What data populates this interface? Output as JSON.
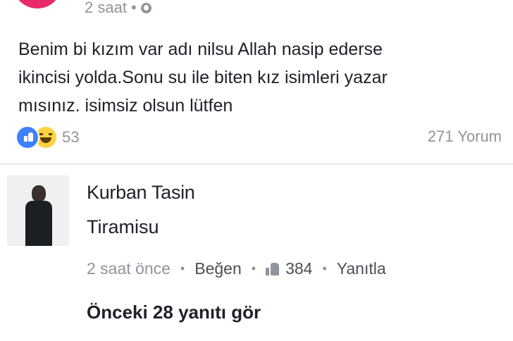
{
  "post": {
    "time": "2 saat",
    "meta_separator": "•",
    "privacy_icon": "globe-icon",
    "text": "Benim bi kızım var adı nilsu Allah nasip ederse\nikincisi yolda.Sonu su ile biten kız isimleri yazar\nmısınız. isimsiz olsun lütfen",
    "reaction_icons": [
      "like-icon",
      "haha-icon"
    ],
    "reaction_count": "53",
    "comment_count": "271 Yorum"
  },
  "comment": {
    "author": "Kurban Tasin",
    "text": "Tiramisu",
    "time": "2 saat önce",
    "separator": "•",
    "like_label": "Beğen",
    "like_icon": "thumbs-up-icon",
    "like_count": "384",
    "reply_label": "Yanıtla"
  },
  "replies": {
    "view_previous": "Önceki 28 yanıtı gör"
  },
  "colors": {
    "like_blue": "#4080ff",
    "haha_yellow": "#fcd341",
    "meta_gray": "#90949c",
    "text_dark": "#1d2129"
  }
}
